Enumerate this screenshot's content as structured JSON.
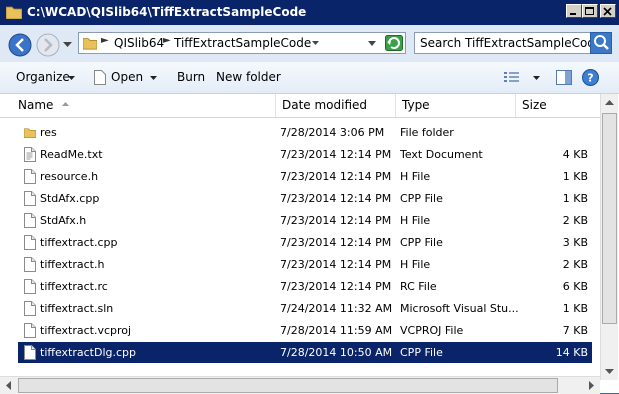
{
  "window": {
    "title": "C:\\WCAD\\QISlib64\\TiffExtractSampleCode"
  },
  "address": {
    "crumbs": [
      "QISlib64",
      "TiffExtractSampleCode"
    ],
    "separator": "►"
  },
  "search": {
    "placeholder": "Search TiffExtractSampleCode"
  },
  "toolbar": {
    "organize_label": "Organize",
    "open_label": "Open",
    "burn_label": "Burn",
    "new_folder_label": "New folder"
  },
  "columns": {
    "name": "Name",
    "date_modified": "Date modified",
    "type": "Type",
    "size": "Size"
  },
  "files": [
    {
      "name": "res",
      "date": "7/28/2014 3:06 PM",
      "type": "File folder",
      "size": "",
      "icon": "folder-icon"
    },
    {
      "name": "ReadMe.txt",
      "date": "7/23/2014 12:14 PM",
      "type": "Text Document",
      "size": "4 KB",
      "icon": "text-file-icon"
    },
    {
      "name": "resource.h",
      "date": "7/23/2014 12:14 PM",
      "type": "H File",
      "size": "1 KB",
      "icon": "file-icon"
    },
    {
      "name": "StdAfx.cpp",
      "date": "7/23/2014 12:14 PM",
      "type": "CPP File",
      "size": "1 KB",
      "icon": "file-icon"
    },
    {
      "name": "StdAfx.h",
      "date": "7/23/2014 12:14 PM",
      "type": "H File",
      "size": "2 KB",
      "icon": "file-icon"
    },
    {
      "name": "tiffextract.cpp",
      "date": "7/23/2014 12:14 PM",
      "type": "CPP File",
      "size": "3 KB",
      "icon": "file-icon"
    },
    {
      "name": "tiffextract.h",
      "date": "7/23/2014 12:14 PM",
      "type": "H File",
      "size": "2 KB",
      "icon": "file-icon"
    },
    {
      "name": "tiffextract.rc",
      "date": "7/23/2014 12:14 PM",
      "type": "RC File",
      "size": "6 KB",
      "icon": "file-icon"
    },
    {
      "name": "tiffextract.sln",
      "date": "7/24/2014 11:32 AM",
      "type": "Microsoft Visual Stu...",
      "size": "1 KB",
      "icon": "file-icon"
    },
    {
      "name": "tiffextract.vcproj",
      "date": "7/28/2014 11:59 AM",
      "type": "VCPROJ File",
      "size": "7 KB",
      "icon": "file-icon"
    },
    {
      "name": "tiffextractDlg.cpp",
      "date": "7/28/2014 10:50 AM",
      "type": "CPP File",
      "size": "14 KB",
      "icon": "file-icon",
      "selected": true
    }
  ],
  "colors": {
    "titlebar": "#0a246a",
    "selection": "#0a246a",
    "folder": "#e8c15a"
  }
}
